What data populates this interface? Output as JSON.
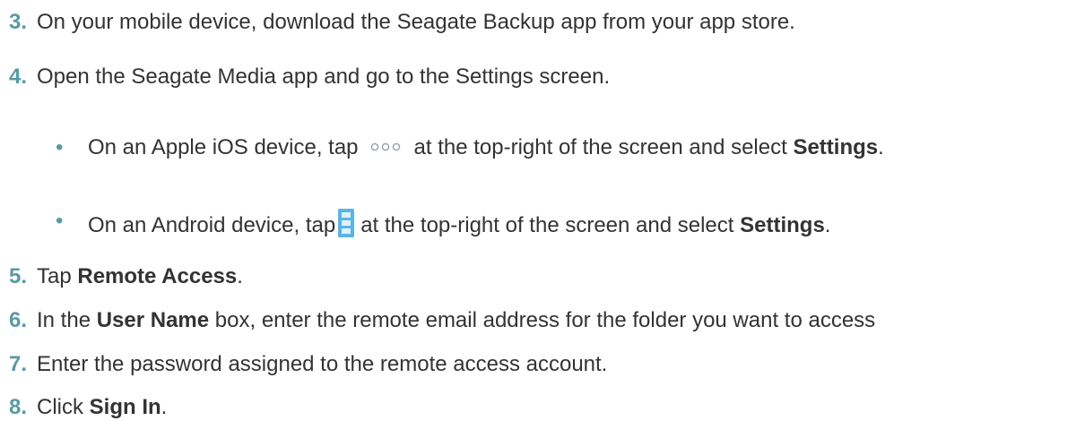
{
  "steps": [
    {
      "num": "3.",
      "text": "On your mobile device, download the Seagate Backup app from your app store."
    },
    {
      "num": "4.",
      "text": "Open the Seagate Media app and go to the Settings screen."
    },
    {
      "num": "5.",
      "pre": "Tap ",
      "bold": "Remote Access",
      "post": "."
    },
    {
      "num": "6.",
      "pre": "In the ",
      "bold": "User Name",
      "post": " box, enter the remote email address for the folder you want to access"
    },
    {
      "num": "7.",
      "text": "Enter the password assigned to the remote access account."
    },
    {
      "num": "8.",
      "pre": "Click ",
      "bold": "Sign In",
      "post": "."
    }
  ],
  "bullets": [
    {
      "dot": "•",
      "pre": "On an Apple iOS device, tap",
      "post": "at the top-right of the screen and select ",
      "bold": "Settings",
      "end": ".",
      "icon": "more-horizontal-icon"
    },
    {
      "dot": "•",
      "pre": "On an Android device, tap",
      "post": "at the top-right of the screen and select ",
      "bold": "Settings",
      "end": ".",
      "icon": "overflow-menu-icon"
    }
  ],
  "colors": {
    "step_number": "#5a9aa3",
    "text": "#333333",
    "icon_blue": "#5ab4e5"
  }
}
